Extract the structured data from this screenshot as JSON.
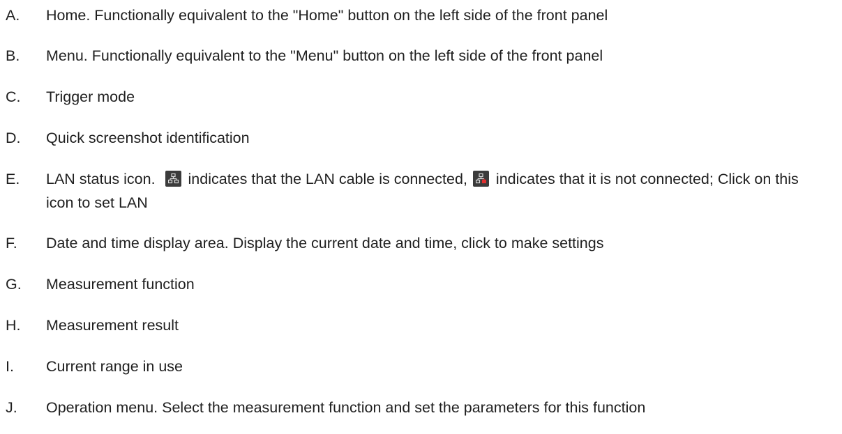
{
  "items": [
    {
      "letter": "A.",
      "text": "Home. Functionally equivalent to the \"Home\" button on the left side of the front panel"
    },
    {
      "letter": "B.",
      "text": "Menu. Functionally equivalent to the \"Menu\" button on the left side of the front panel"
    },
    {
      "letter": "C.",
      "text": "Trigger mode"
    },
    {
      "letter": "D.",
      "text": "Quick screenshot identification"
    },
    {
      "letter": "E.",
      "text_before": "LAN status icon.",
      "text_middle": "indicates that the LAN cable is connected,",
      "text_after": "indicates that it is not connected; Click on this icon to set LAN",
      "icon_connected": "lan-connected-icon",
      "icon_disconnected": "lan-disconnected-icon"
    },
    {
      "letter": "F.",
      "text": "Date and time display area. Display the current date and time, click to make settings"
    },
    {
      "letter": "G.",
      "text": "Measurement function"
    },
    {
      "letter": "H.",
      "text": "Measurement result"
    },
    {
      "letter": "I.",
      "text": "Current range in use"
    },
    {
      "letter": "J.",
      "text": "Operation menu. Select the measurement function and set the parameters for this function"
    }
  ],
  "colors": {
    "text": "#1f1f1f",
    "icon_bg": "#3b3b3b",
    "icon_connected": "#d9d9d9",
    "icon_disconnected": "#e03030"
  }
}
